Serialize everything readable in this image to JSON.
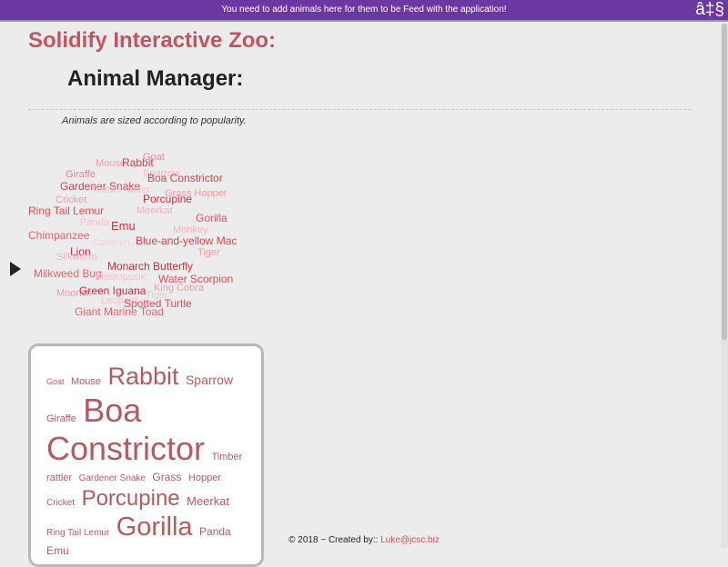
{
  "topbar": {
    "message": "You need to add animals here for them to be Feed with the application!",
    "icon_text": "â‡§"
  },
  "page_title": "Solidify Interactive Zoo:",
  "section_title": "Animal Manager:",
  "subtitle": "Animals are sized according to popularity.",
  "cloud_words": [
    {
      "text": "Goat",
      "color": "#e8909a"
    },
    {
      "text": "Mouse",
      "color": "#ee9da6"
    },
    {
      "text": "Rabbit",
      "color": "#d93a48"
    },
    {
      "text": "Sparrow",
      "color": "#f3b4bb"
    },
    {
      "text": "Giraffe",
      "color": "#ea7f8a"
    },
    {
      "text": "Boa Constrictor",
      "color": "#d9404e"
    },
    {
      "text": "Gardener Snake",
      "color": "#d73a49"
    },
    {
      "text": "Timber rattler",
      "color": "#f5c3c8"
    },
    {
      "text": "Grass Hopper",
      "color": "#ef9ca5"
    },
    {
      "text": "Cricket",
      "color": "#ef9ca5"
    },
    {
      "text": "Porcupine",
      "color": "#d92c3c"
    },
    {
      "text": "Ring Tail Lemur",
      "color": "#e04a58"
    },
    {
      "text": "Meerkat",
      "color": "#f3b4bb"
    },
    {
      "text": "Gorilla",
      "color": "#e0505e"
    },
    {
      "text": "Panda",
      "color": "#f5c3c8"
    },
    {
      "text": "Emu",
      "color": "#d62a3a"
    },
    {
      "text": "Monkey",
      "color": "#f3b4bb"
    },
    {
      "text": "Chimpanzee",
      "color": "#e85f6c"
    },
    {
      "text": "Common",
      "color": "#f7d0d4"
    },
    {
      "text": "Blue-and-yellow Mac",
      "color": "#e23c4b"
    },
    {
      "text": "Lion",
      "color": "#d62a3a"
    },
    {
      "text": "Tiger",
      "color": "#ef9ca5"
    },
    {
      "text": "Silkworm",
      "color": "#f3b4bb"
    },
    {
      "text": "Monarch Butterfly",
      "color": "#d62a3a"
    },
    {
      "text": "Milkweed Bug",
      "color": "#e85f6c"
    },
    {
      "text": "Skeltopusik",
      "color": "#f5c3c8"
    },
    {
      "text": "Water Scorpion",
      "color": "#e04a58"
    },
    {
      "text": "King Cobra",
      "color": "#ef9ca5"
    },
    {
      "text": "Moonsh",
      "color": "#ef9ca5"
    },
    {
      "text": "Green Iguana",
      "color": "#d62a3a"
    },
    {
      "text": "Leopard",
      "color": "#f5c3c8"
    },
    {
      "text": "Tiger",
      "color": "#f5c3c8"
    },
    {
      "text": "Spotted Turtle",
      "color": "#e04a58"
    },
    {
      "text": "Giant Marine Toad",
      "color": "#e85f6c"
    }
  ],
  "card_words": [
    {
      "text": "Goat"
    },
    {
      "text": "Mouse"
    },
    {
      "text": "Rabbit"
    },
    {
      "text": "Sparrow"
    },
    {
      "text": "Giraffe"
    },
    {
      "text": "Boa"
    },
    {
      "text": "Constrictor"
    },
    {
      "text": "Timber rattler"
    },
    {
      "text": "Gardener Snake"
    },
    {
      "text": "Grass"
    },
    {
      "text": "Hopper"
    },
    {
      "text": "Cricket"
    },
    {
      "text": "Porcupine"
    },
    {
      "text": "Meerkat"
    },
    {
      "text": "Ring Tail Lemur"
    },
    {
      "text": "Gorilla"
    },
    {
      "text": "Panda"
    },
    {
      "text": "Emu"
    }
  ],
  "footer": {
    "text": "© 2018 ~ Created by:: ",
    "link_label": "Luke@jcsc.biz"
  },
  "icons": {
    "play": "play-icon"
  }
}
